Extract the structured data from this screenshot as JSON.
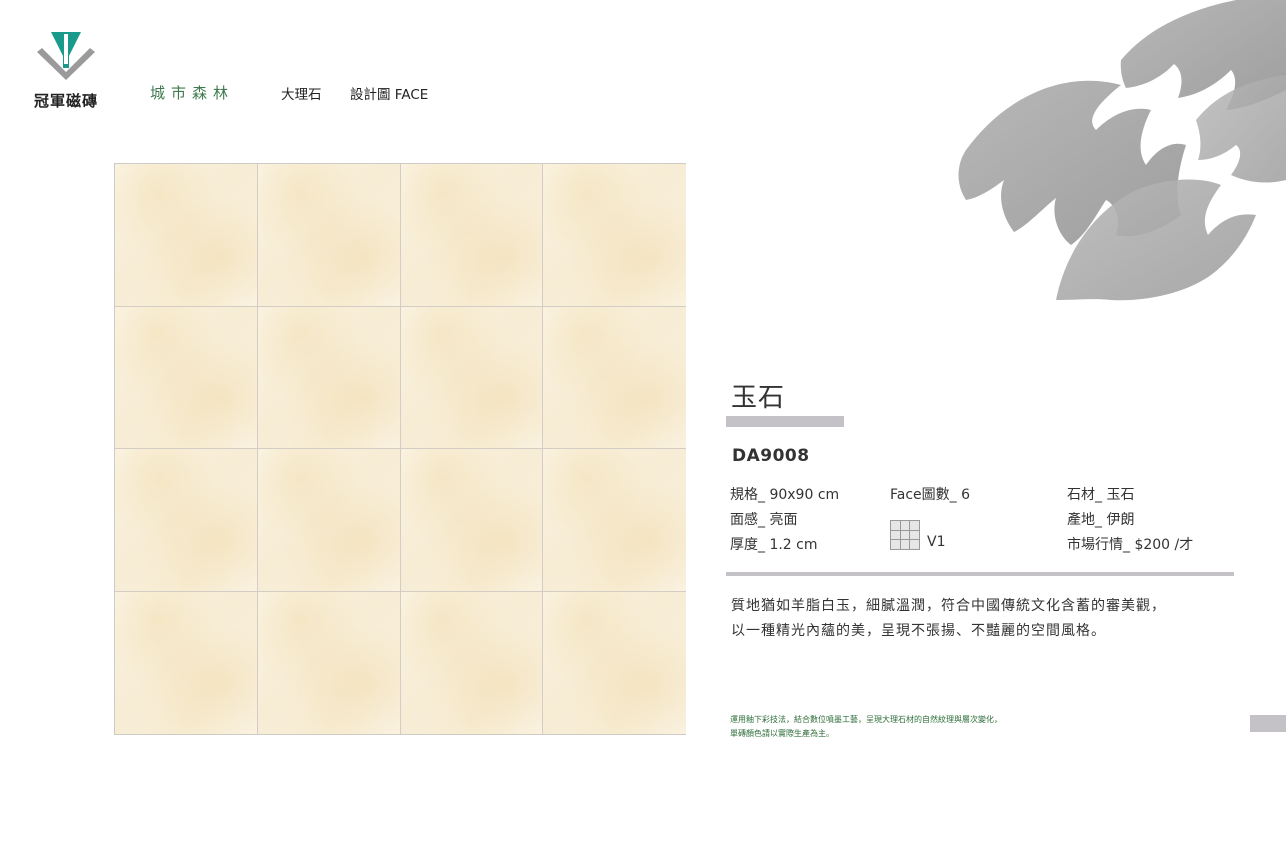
{
  "brand": {
    "name": "冠軍磁磚",
    "logo_colors": {
      "teal": "#1a9a8a",
      "gray": "#9a9a9a"
    }
  },
  "nav": {
    "series": "城市森林",
    "category": "大理石",
    "face_label": "設計圖 FACE"
  },
  "product": {
    "name": "玉石",
    "code": "DA9008",
    "specs": {
      "size": "規格_ 90x90 cm",
      "finish": "面感_ 亮面",
      "thickness": "厚度_ 1.2 cm",
      "face_count": "Face圖數_ 6",
      "variation": "V1",
      "material": "石材_ 玉石",
      "origin": "產地_ 伊朗",
      "price": "市場行情_ $200 /才"
    },
    "description_lines": [
      "質地猶如羊脂白玉，細膩溫潤，符合中國傳統文化含蓄的審美觀，",
      "以一種精光內蘊的美，呈現不張揚、不豔麗的空間風格。"
    ],
    "note_lines": [
      "運用釉下彩技法，結合數位噴墨工藝，呈現大理石材的自然紋理與層次變化，",
      "單磚顏色請以實際生產為主。"
    ]
  },
  "tile_grid": {
    "rows": 4,
    "cols": 4
  },
  "colors": {
    "accent_gray": "#c4c2c7",
    "series_green": "#3f7a4e",
    "note_green": "#2f6e3a",
    "tile_base": "#f8efdc"
  }
}
